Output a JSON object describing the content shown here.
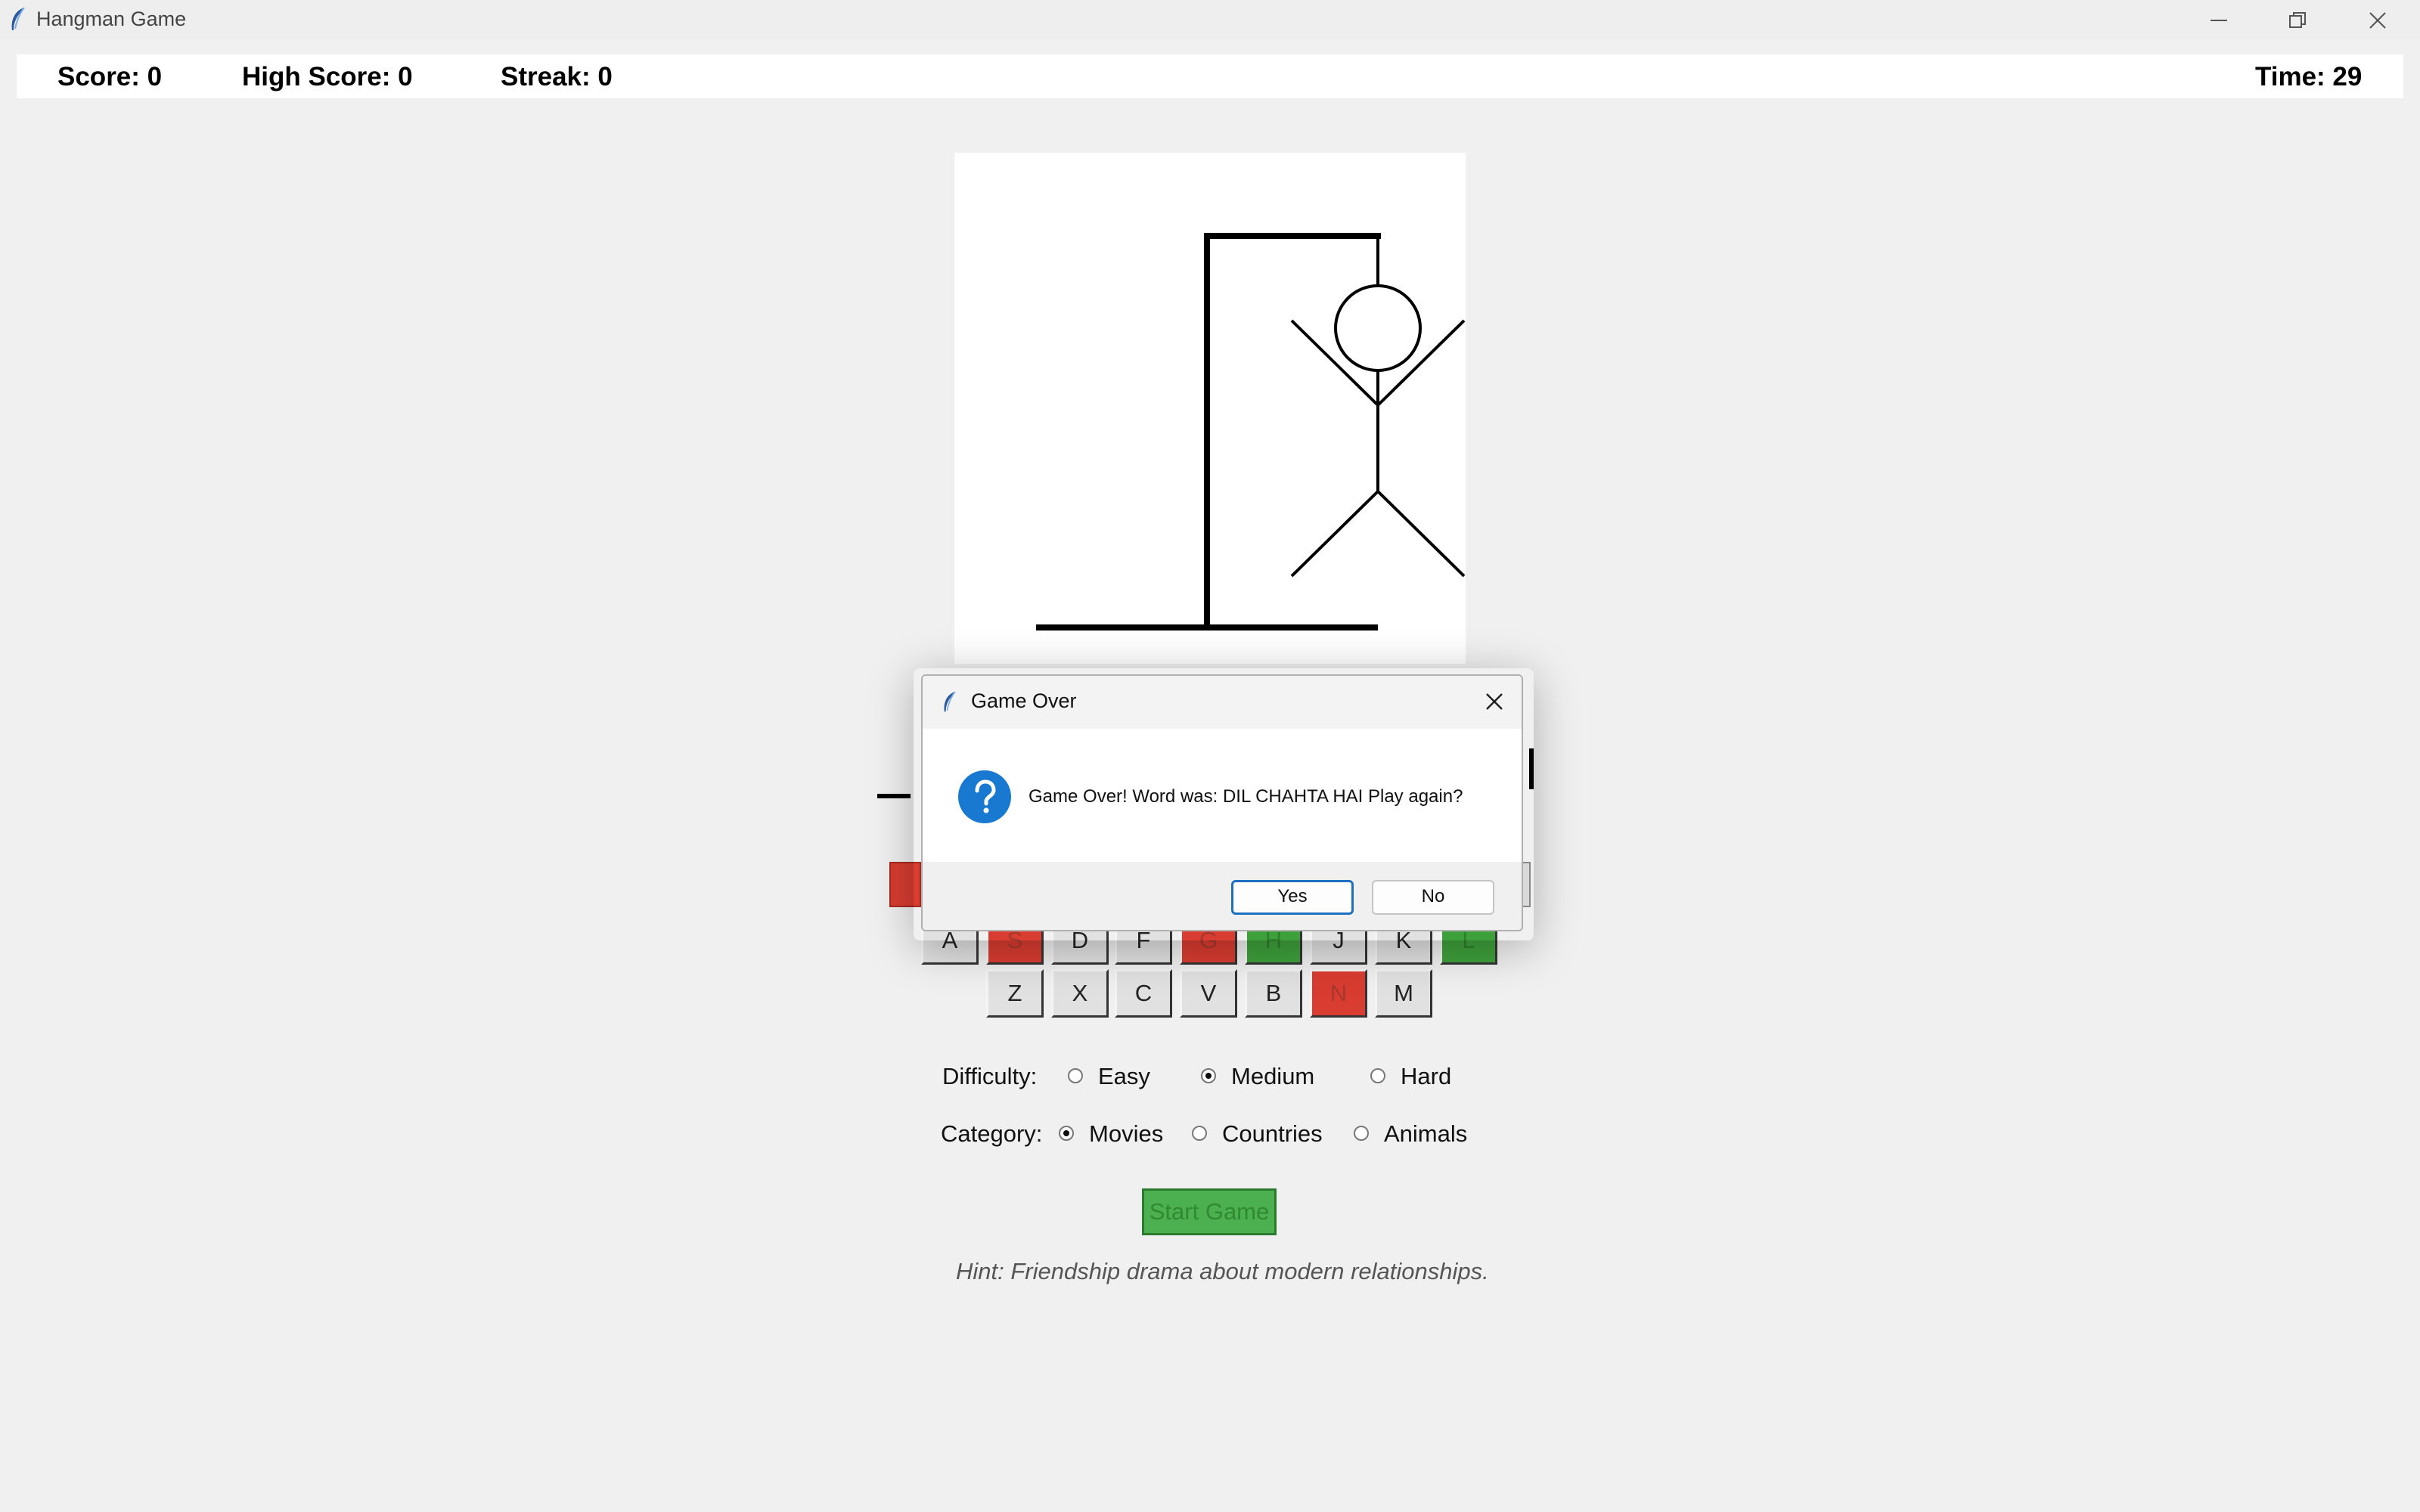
{
  "window": {
    "title": "Hangman Game",
    "minimize": "–",
    "restore": "❐",
    "close": "✕"
  },
  "status": {
    "score": "Score: 0",
    "high_score": "High Score: 0",
    "streak": "Streak: 0",
    "time": "Time: 29"
  },
  "keyboard": {
    "row2": [
      {
        "letter": "A",
        "state": "default"
      },
      {
        "letter": "S",
        "state": "wrong"
      },
      {
        "letter": "D",
        "state": "default"
      },
      {
        "letter": "F",
        "state": "default"
      },
      {
        "letter": "G",
        "state": "wrong"
      },
      {
        "letter": "H",
        "state": "correct"
      },
      {
        "letter": "J",
        "state": "default"
      },
      {
        "letter": "K",
        "state": "default"
      },
      {
        "letter": "L",
        "state": "correct"
      }
    ],
    "row3": [
      {
        "letter": "Z",
        "state": "default"
      },
      {
        "letter": "X",
        "state": "default"
      },
      {
        "letter": "C",
        "state": "default"
      },
      {
        "letter": "V",
        "state": "default"
      },
      {
        "letter": "B",
        "state": "default"
      },
      {
        "letter": "N",
        "state": "wrong"
      },
      {
        "letter": "M",
        "state": "default"
      }
    ]
  },
  "colors": {
    "wrong": "#d93c30",
    "correct": "#3ea03b",
    "start": "#4caf50"
  },
  "difficulty": {
    "label": "Difficulty:",
    "options": [
      {
        "label": "Easy",
        "selected": false
      },
      {
        "label": "Medium",
        "selected": true
      },
      {
        "label": "Hard",
        "selected": false
      }
    ]
  },
  "category": {
    "label": "Category:",
    "options": [
      {
        "label": "Movies",
        "selected": true
      },
      {
        "label": "Countries",
        "selected": false
      },
      {
        "label": "Animals",
        "selected": false
      }
    ]
  },
  "start_button": "Start Game",
  "hint": "Hint: Friendship drama about modern relationships.",
  "dialog": {
    "title": "Game Over",
    "icon": "question-icon",
    "message": "Game Over! Word was: DIL CHAHTA HAI Play again?",
    "yes": "Yes",
    "no": "No"
  }
}
